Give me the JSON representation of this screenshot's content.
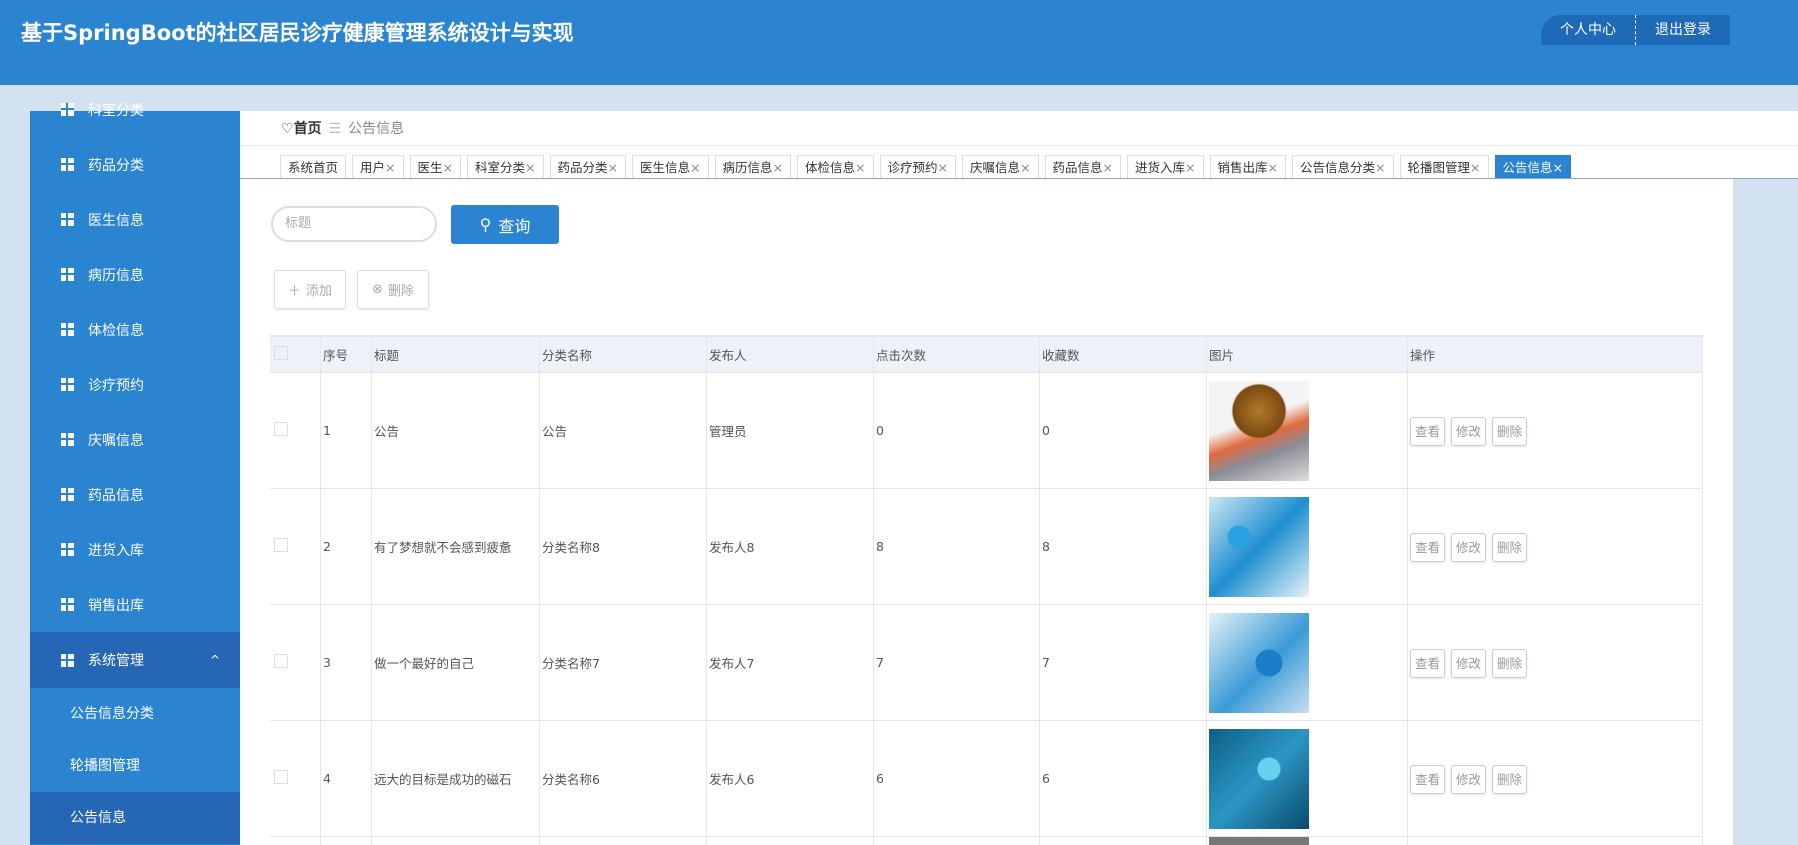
{
  "header": {
    "title": "基于SpringBoot的社区居民诊疗健康管理系统设计与实现",
    "profile": "个人中心",
    "logout": "退出登录"
  },
  "sidebar": {
    "items": [
      "科室分类",
      "药品分类",
      "医生信息",
      "病历信息",
      "体检信息",
      "诊疗预约",
      "庆嘱信息",
      "药品信息",
      "进货入库",
      "销售出库"
    ],
    "group": "系统管理",
    "subs": [
      "公告信息分类",
      "轮播图管理",
      "公告信息"
    ]
  },
  "breadcrumb": {
    "home": "首页",
    "sep": "☰",
    "current": "公告信息"
  },
  "tabs": [
    "系统首页",
    "用户",
    "医生",
    "科室分类",
    "药品分类",
    "医生信息",
    "病历信息",
    "体检信息",
    "诊疗预约",
    "庆嘱信息",
    "药品信息",
    "进货入库",
    "销售出库",
    "公告信息分类",
    "轮播图管理",
    "公告信息"
  ],
  "search": {
    "placeholder": "标题",
    "button": "查询"
  },
  "actions": {
    "add": "添加",
    "delete": "删除"
  },
  "table": {
    "headers": [
      "序号",
      "标题",
      "分类名称",
      "发布人",
      "点击次数",
      "收藏数",
      "图片",
      "操作"
    ],
    "rows": [
      {
        "id": "1",
        "title": "公告",
        "category": "公告",
        "publisher": "管理员",
        "clicks": "0",
        "favs": "0"
      },
      {
        "id": "2",
        "title": "有了梦想就不会感到疲惫",
        "category": "分类名称8",
        "publisher": "发布人8",
        "clicks": "8",
        "favs": "8"
      },
      {
        "id": "3",
        "title": "做一个最好的自己",
        "category": "分类名称7",
        "publisher": "发布人7",
        "clicks": "7",
        "favs": "7"
      },
      {
        "id": "4",
        "title": "远大的目标是成功的磁石",
        "category": "分类名称6",
        "publisher": "发布人6",
        "clicks": "6",
        "favs": "6"
      }
    ],
    "ops": [
      "查看",
      "修改",
      "删除"
    ]
  }
}
